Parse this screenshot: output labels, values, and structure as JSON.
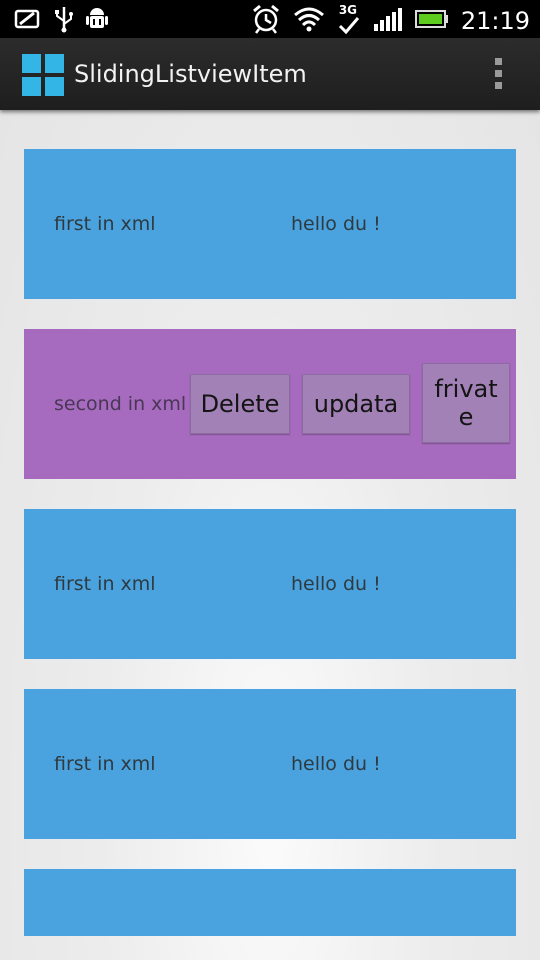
{
  "status_bar": {
    "time": "21:19",
    "network_label": "3G",
    "icons": [
      "screenshot-icon",
      "usb-icon",
      "android-debug-icon",
      "alarm-icon",
      "wifi-icon",
      "network-3g-icon",
      "signal-icon",
      "battery-icon"
    ]
  },
  "action_bar": {
    "title": "SlidingListviewItem",
    "overflow_icon": "overflow-menu-icon"
  },
  "list": {
    "items": [
      {
        "left": "first in xml",
        "right": "hello du !"
      },
      {
        "left": "second in xml",
        "buttons": [
          "Delete",
          "updata",
          "frivat\ne"
        ]
      },
      {
        "left": "first in xml",
        "right": "hello du !"
      },
      {
        "left": "first in xml",
        "right": "hello du !"
      },
      {
        "left": "",
        "right": ""
      }
    ]
  },
  "colors": {
    "row_blue": "#4aa3df",
    "row_purple": "#a66bbe",
    "button": "#a281b6",
    "actionbar": "#222222",
    "app_icon": "#33b5e5"
  }
}
